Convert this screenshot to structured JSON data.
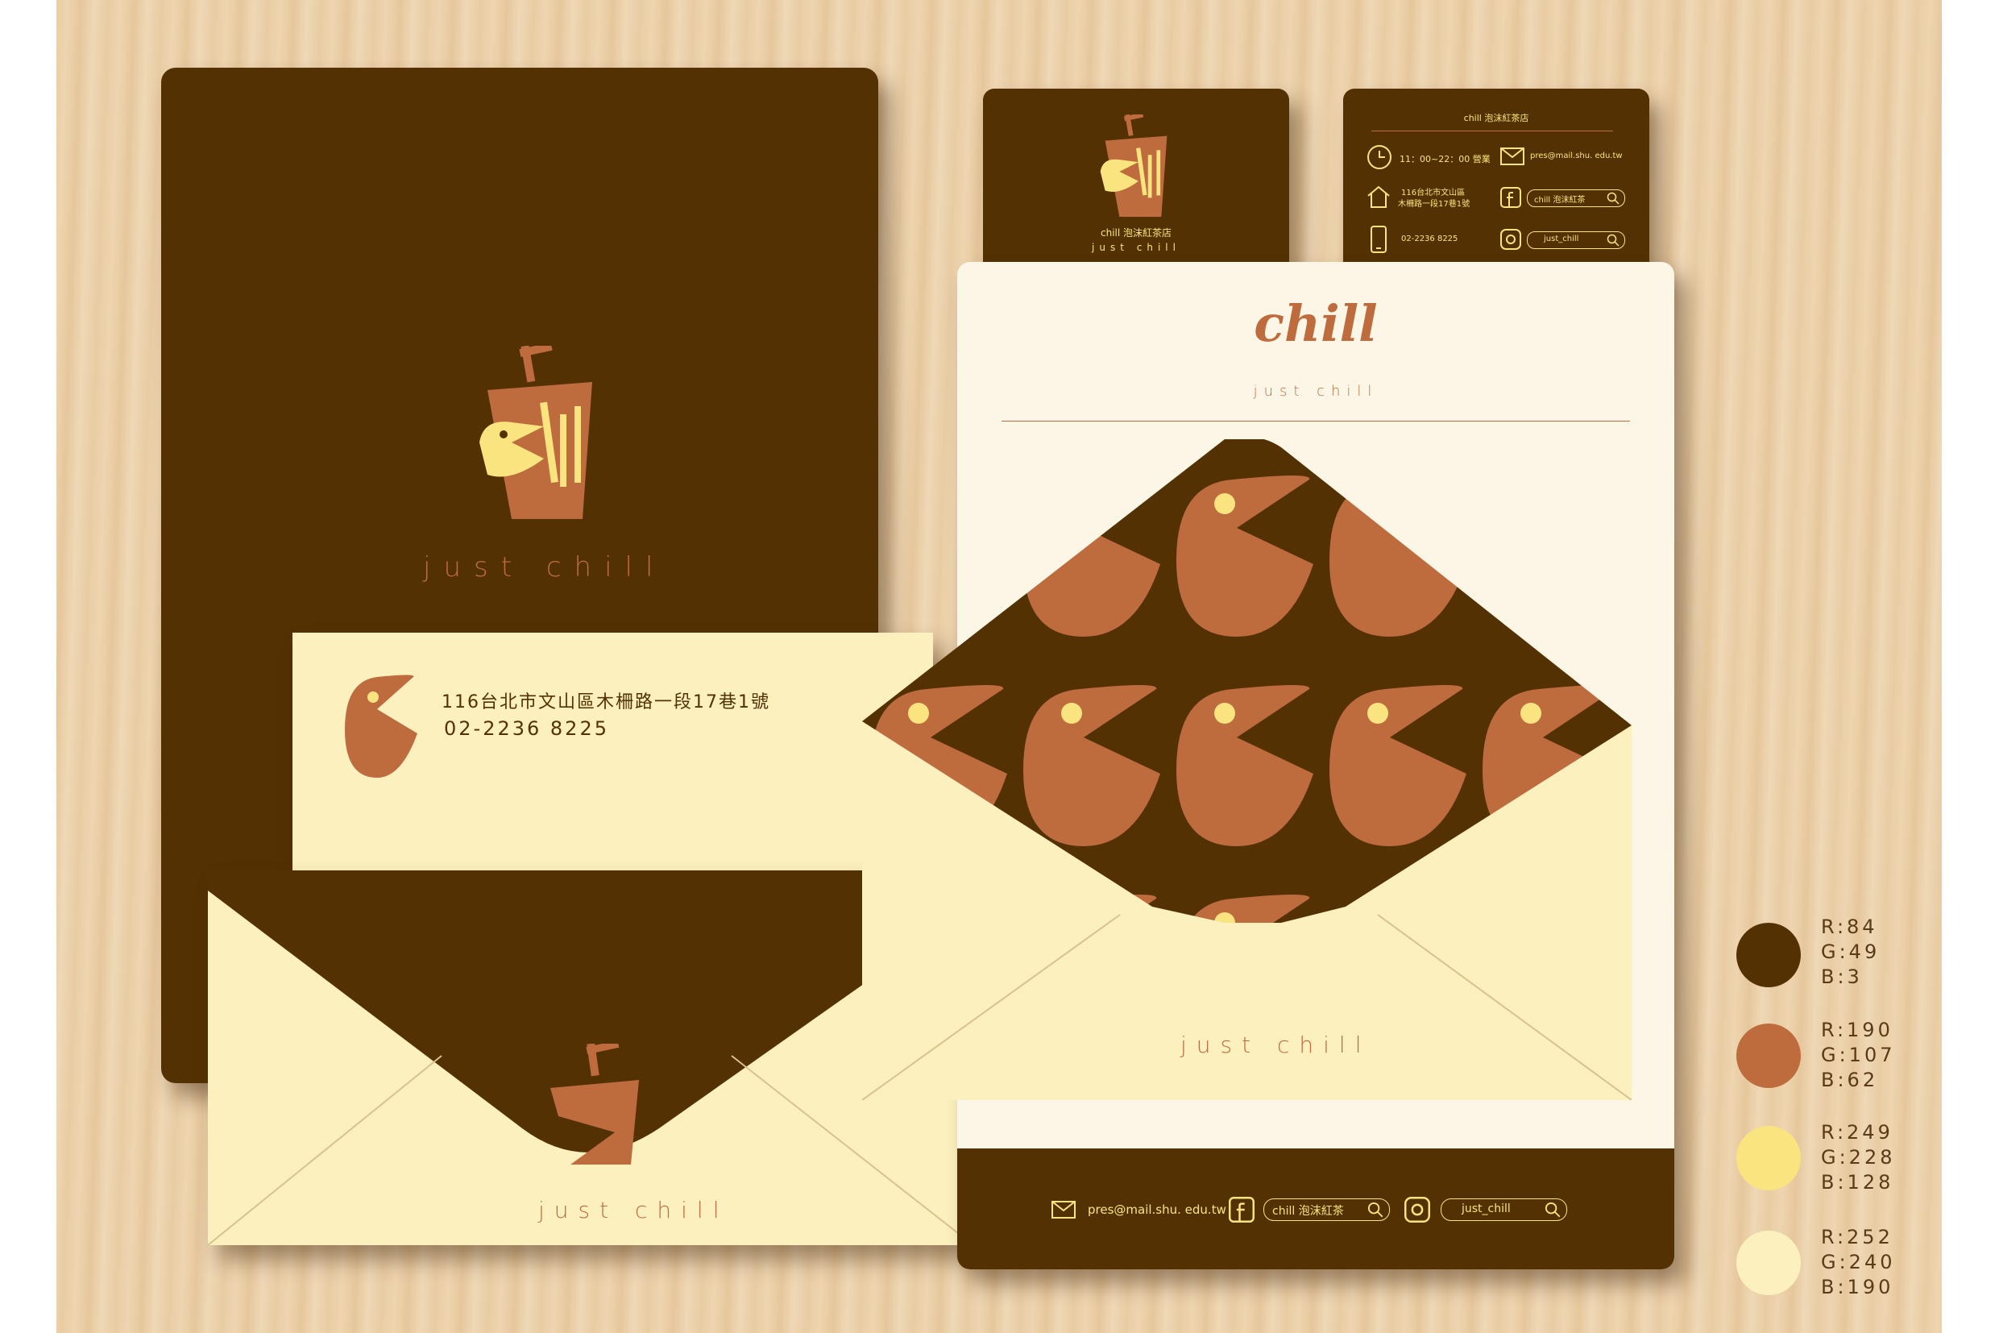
{
  "brand": {
    "logo_word": "chill",
    "tagline": "just chill"
  },
  "envelope_label": {
    "address": "116台北市文山區木柵路一段17巷1號",
    "phone": "02-2236 8225"
  },
  "card_front": {
    "name": "chill 泡沫紅茶店",
    "tagline": "just chill"
  },
  "card_back": {
    "title": "chill 泡沫紅茶店",
    "hours": "11：00~22：00 營業",
    "email": "pres@mail.shu. edu.tw",
    "address_line1": "116台北市文山區",
    "address_line2": "木柵路一段17巷1號",
    "facebook": "chill 泡沫紅茶",
    "phone": "02-2236 8225",
    "instagram": "just_chill"
  },
  "letterhead_footer": {
    "email": "pres@mail.shu. edu.tw",
    "facebook": "chill 泡沫紅茶",
    "instagram": "just_chill"
  },
  "palette": [
    {
      "hex": "#543103",
      "r": "R:84",
      "g": "G:49",
      "b": "B:3"
    },
    {
      "hex": "#be6b3e",
      "r": "R:190",
      "g": "G:107",
      "b": "B:62"
    },
    {
      "hex": "#f9e480",
      "r": "R:249",
      "g": "G:228",
      "b": "B:128"
    },
    {
      "hex": "#fcf0be",
      "r": "R:252",
      "g": "G:240",
      "b": "B:190"
    }
  ],
  "icons": [
    "clock-icon",
    "mail-icon",
    "house-icon",
    "facebook-icon",
    "phone-icon",
    "instagram-icon",
    "search-icon"
  ]
}
